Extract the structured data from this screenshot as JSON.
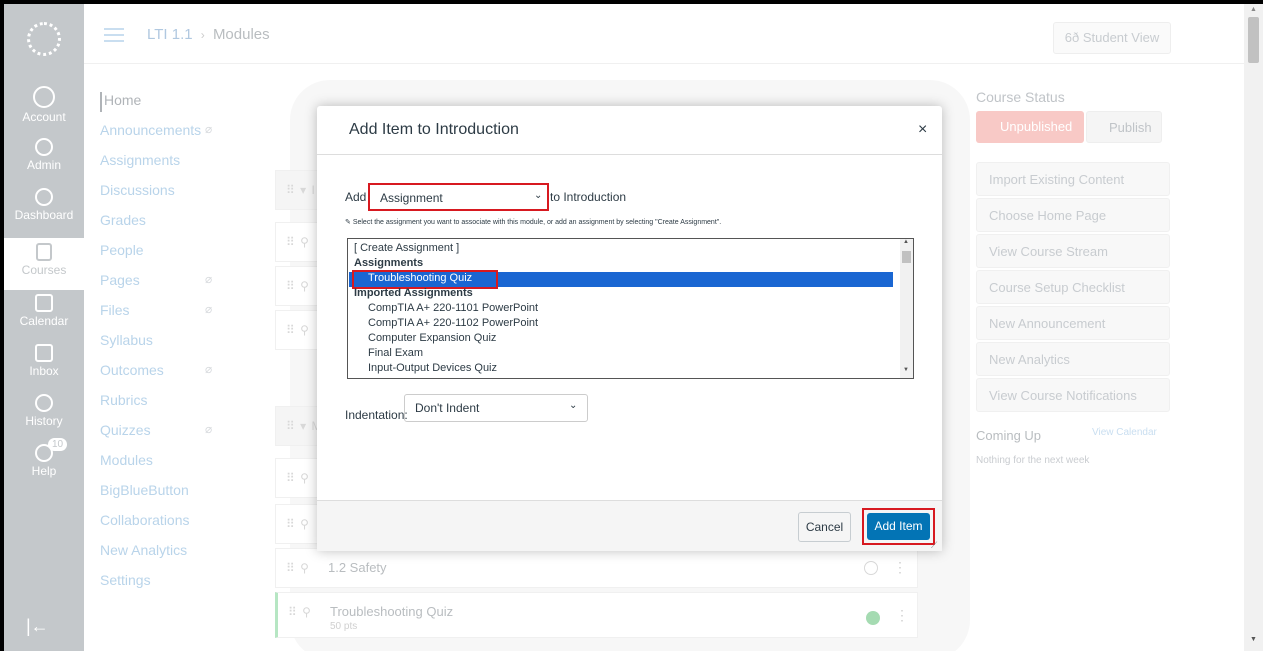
{
  "global_nav": {
    "items": [
      {
        "label": "Account",
        "icon": "account-icon"
      },
      {
        "label": "Admin",
        "icon": "admin-icon"
      },
      {
        "label": "Dashboard",
        "icon": "dashboard-icon"
      },
      {
        "label": "Courses",
        "icon": "courses-icon"
      },
      {
        "label": "Calendar",
        "icon": "calendar-icon"
      },
      {
        "label": "Inbox",
        "icon": "inbox-icon"
      },
      {
        "label": "History",
        "icon": "history-icon"
      },
      {
        "label": "Help",
        "icon": "help-icon"
      }
    ],
    "help_badge": "10",
    "collapse_glyph": "|←"
  },
  "header": {
    "course": "LTI 1.1",
    "separator": "›",
    "page": "Modules",
    "student_view": "6ð Student View"
  },
  "course_nav": {
    "items": [
      {
        "label": "Home"
      },
      {
        "label": "Announcements",
        "hidden": "⌀"
      },
      {
        "label": "Assignments"
      },
      {
        "label": "Discussions"
      },
      {
        "label": "Grades"
      },
      {
        "label": "People"
      },
      {
        "label": "Pages",
        "hidden": "⌀"
      },
      {
        "label": "Files",
        "hidden": "⌀"
      },
      {
        "label": "Syllabus"
      },
      {
        "label": "Outcomes",
        "hidden": "⌀"
      },
      {
        "label": "Rubrics"
      },
      {
        "label": "Quizzes",
        "hidden": "⌀"
      },
      {
        "label": "Modules"
      },
      {
        "label": "BigBlueButton"
      },
      {
        "label": "Collaborations"
      },
      {
        "label": "New Analytics"
      },
      {
        "label": "Settings"
      }
    ]
  },
  "background_modules": {
    "header_row_glyph": "⠿ ▾ I",
    "header2_row_glyph": "⠿ ▾ M",
    "row_glyph": "⠿ ⚲",
    "safety_title": "1.2 Safety",
    "quiz_title": "Troubleshooting Quiz",
    "quiz_points": "50 pts",
    "kebab": "⋮"
  },
  "sidebar": {
    "course_status": "Course Status",
    "unpublished": "Unpublished",
    "publish": "Publish",
    "buttons": [
      "Import Existing Content",
      "Choose Home Page",
      "View Course Stream",
      "Course Setup Checklist",
      "New Announcement",
      "New Analytics",
      "View Course Notifications"
    ],
    "coming_up": "Coming Up",
    "view_calendar": "View Calendar",
    "nothing": "Nothing for the next week"
  },
  "dialog": {
    "title": "Add Item to Introduction",
    "close": "×",
    "add_label": "Add",
    "type_value": "Assignment",
    "to_label": "to Introduction",
    "help_text": "Select the assignment you want to associate with this module, or add an assignment by selecting \"Create Assignment\".",
    "options": {
      "create": "[ Create Assignment ]",
      "group1": "Assignments",
      "selected": "Troubleshooting Quiz",
      "group2": "Imported Assignments",
      "items": [
        "CompTIA A+ 220-1101 PowerPoint",
        "CompTIA A+ 220-1102 PowerPoint",
        "Computer Expansion Quiz",
        "Final Exam",
        "Input-Output Devices Quiz"
      ]
    },
    "indentation_label": "Indentation:",
    "indentation_value": "Don't Indent",
    "cancel": "Cancel",
    "add_item": "Add Item"
  },
  "colors": {
    "highlight_red": "#d71920",
    "selection_blue": "#1a66d2",
    "primary_blue": "#0374b5"
  }
}
